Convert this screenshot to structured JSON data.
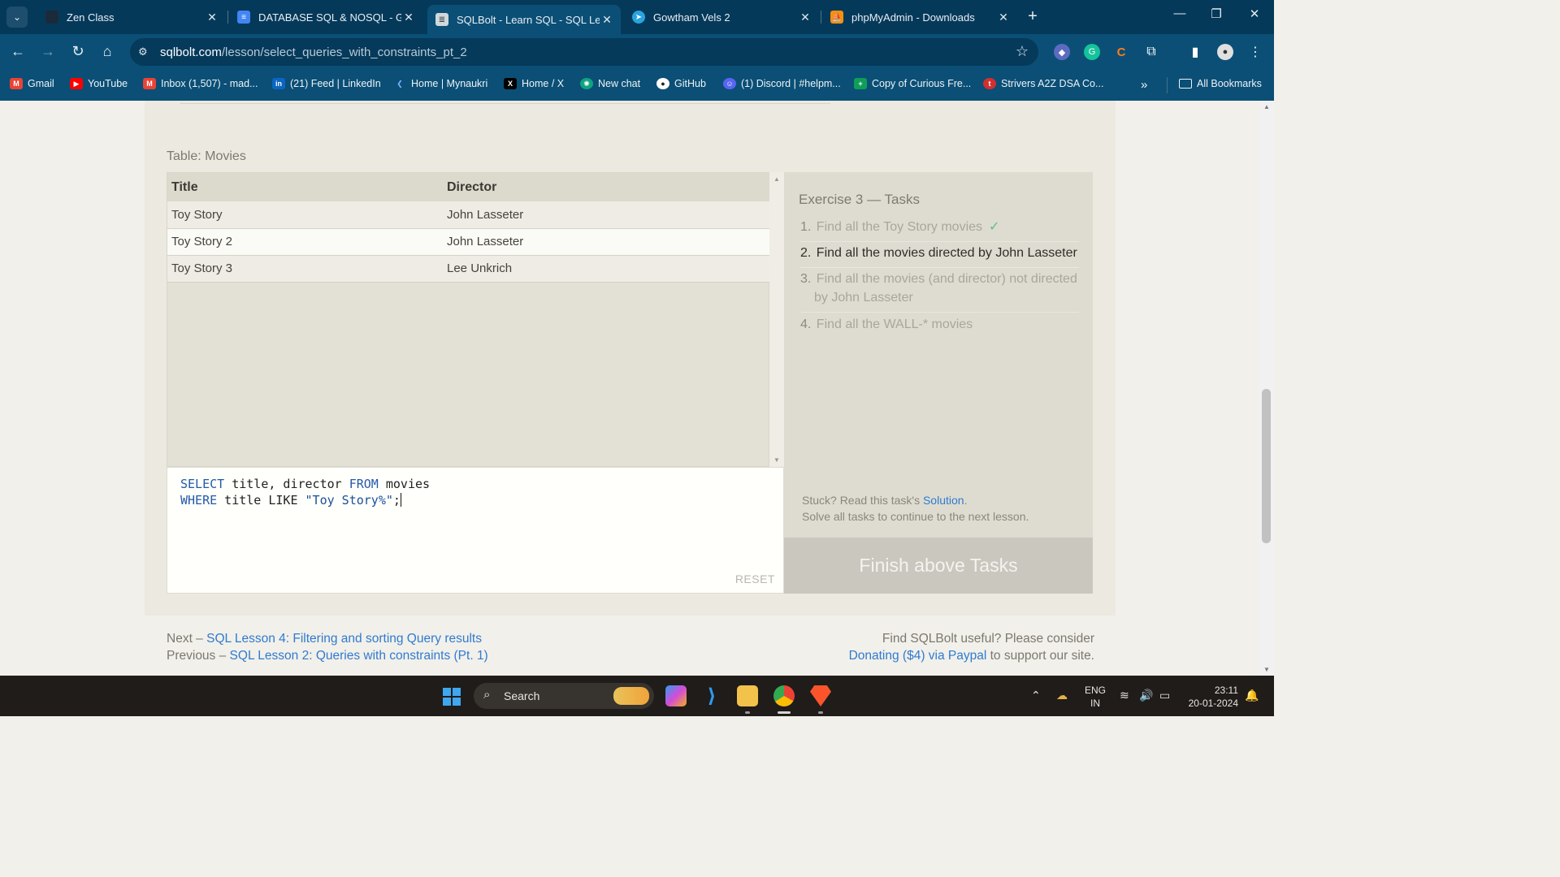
{
  "browser": {
    "tabs": [
      {
        "title": "Zen Class",
        "favicon": "zen-icon",
        "active": false
      },
      {
        "title": "DATABASE SQL & NOSQL - Goo",
        "favicon": "docs-icon",
        "active": false
      },
      {
        "title": "SQLBolt - Learn SQL - SQL Less",
        "favicon": "sqlbolt-icon",
        "active": true
      },
      {
        "title": "Gowtham Vels 2",
        "favicon": "telegram-icon",
        "active": false
      },
      {
        "title": "phpMyAdmin - Downloads",
        "favicon": "phpmyadmin-icon",
        "active": false
      }
    ],
    "url_domain": "sqlbolt.com",
    "url_path": "/lesson/select_queries_with_constraints_pt_2",
    "bookmarks": [
      {
        "label": "Gmail",
        "icon": "gmail-icon",
        "color": "#ea4335"
      },
      {
        "label": "YouTube",
        "icon": "youtube-icon",
        "color": "#ff0000"
      },
      {
        "label": "Inbox (1,507) - mad...",
        "icon": "gmail-icon",
        "color": "#ea4335"
      },
      {
        "label": "(21) Feed | LinkedIn",
        "icon": "linkedin-icon",
        "color": "#0a66c2"
      },
      {
        "label": "Home | Mynaukri",
        "icon": "naukri-icon",
        "color": "#4a90e2"
      },
      {
        "label": "Home / X",
        "icon": "x-icon",
        "color": "#000000"
      },
      {
        "label": "New chat",
        "icon": "chatgpt-icon",
        "color": "#10a37f"
      },
      {
        "label": "GitHub",
        "icon": "github-icon",
        "color": "#222222"
      },
      {
        "label": "(1) Discord | #helpm...",
        "icon": "discord-icon",
        "color": "#5865f2"
      },
      {
        "label": "Copy of Curious Fre...",
        "icon": "sheets-icon",
        "color": "#0f9d58"
      },
      {
        "label": "Strivers A2Z DSA Co...",
        "icon": "tuf-icon",
        "color": "#d32f2f"
      }
    ],
    "all_bookmarks": "All Bookmarks"
  },
  "page": {
    "table_label": "Table: Movies",
    "columns": [
      "Title",
      "Director"
    ],
    "rows": [
      [
        "Toy Story",
        "John Lasseter"
      ],
      [
        "Toy Story 2",
        "John Lasseter"
      ],
      [
        "Toy Story 3",
        "Lee Unkrich"
      ]
    ],
    "query_line1": {
      "kw1": "SELECT",
      "cols": " title, director ",
      "kw2": "FROM",
      "tbl": " movies"
    },
    "query_line2": {
      "kw1": "WHERE",
      "rest": " title LIKE ",
      "str": "\"Toy Story%\"",
      "end": ";"
    },
    "reset_label": "RESET",
    "exercise_title": "Exercise 3 — Tasks",
    "tasks": [
      {
        "num": "1.",
        "text": "Find all the Toy Story movies",
        "done": true
      },
      {
        "num": "2.",
        "text": "Find all the movies directed by John Lasseter",
        "done": false
      },
      {
        "num": "3.",
        "text": "Find all the movies (and director) not directed by John Lasseter",
        "done": false
      },
      {
        "num": "4.",
        "text": "Find all the WALL-* movies",
        "done": false
      }
    ],
    "check_mark": "✓",
    "stuck_prefix": "Stuck? Read this task's ",
    "solution_link": "Solution",
    "stuck_suffix": ".",
    "solve_all": "Solve all tasks to continue to the next lesson.",
    "finish_button": "Finish above Tasks",
    "next_prefix": "Next – ",
    "next_link": "SQL Lesson 4: Filtering and sorting Query results",
    "prev_prefix": "Previous – ",
    "prev_link": "SQL Lesson 2: Queries with constraints (Pt. 1)",
    "useful_text": "Find SQLBolt useful? Please consider",
    "donate_link": "Donating ($4) via Paypal",
    "donate_suffix": " to support our site."
  },
  "taskbar": {
    "search": "Search",
    "lang_line1": "ENG",
    "lang_line2": "IN",
    "time": "23:11",
    "date": "20-01-2024"
  }
}
